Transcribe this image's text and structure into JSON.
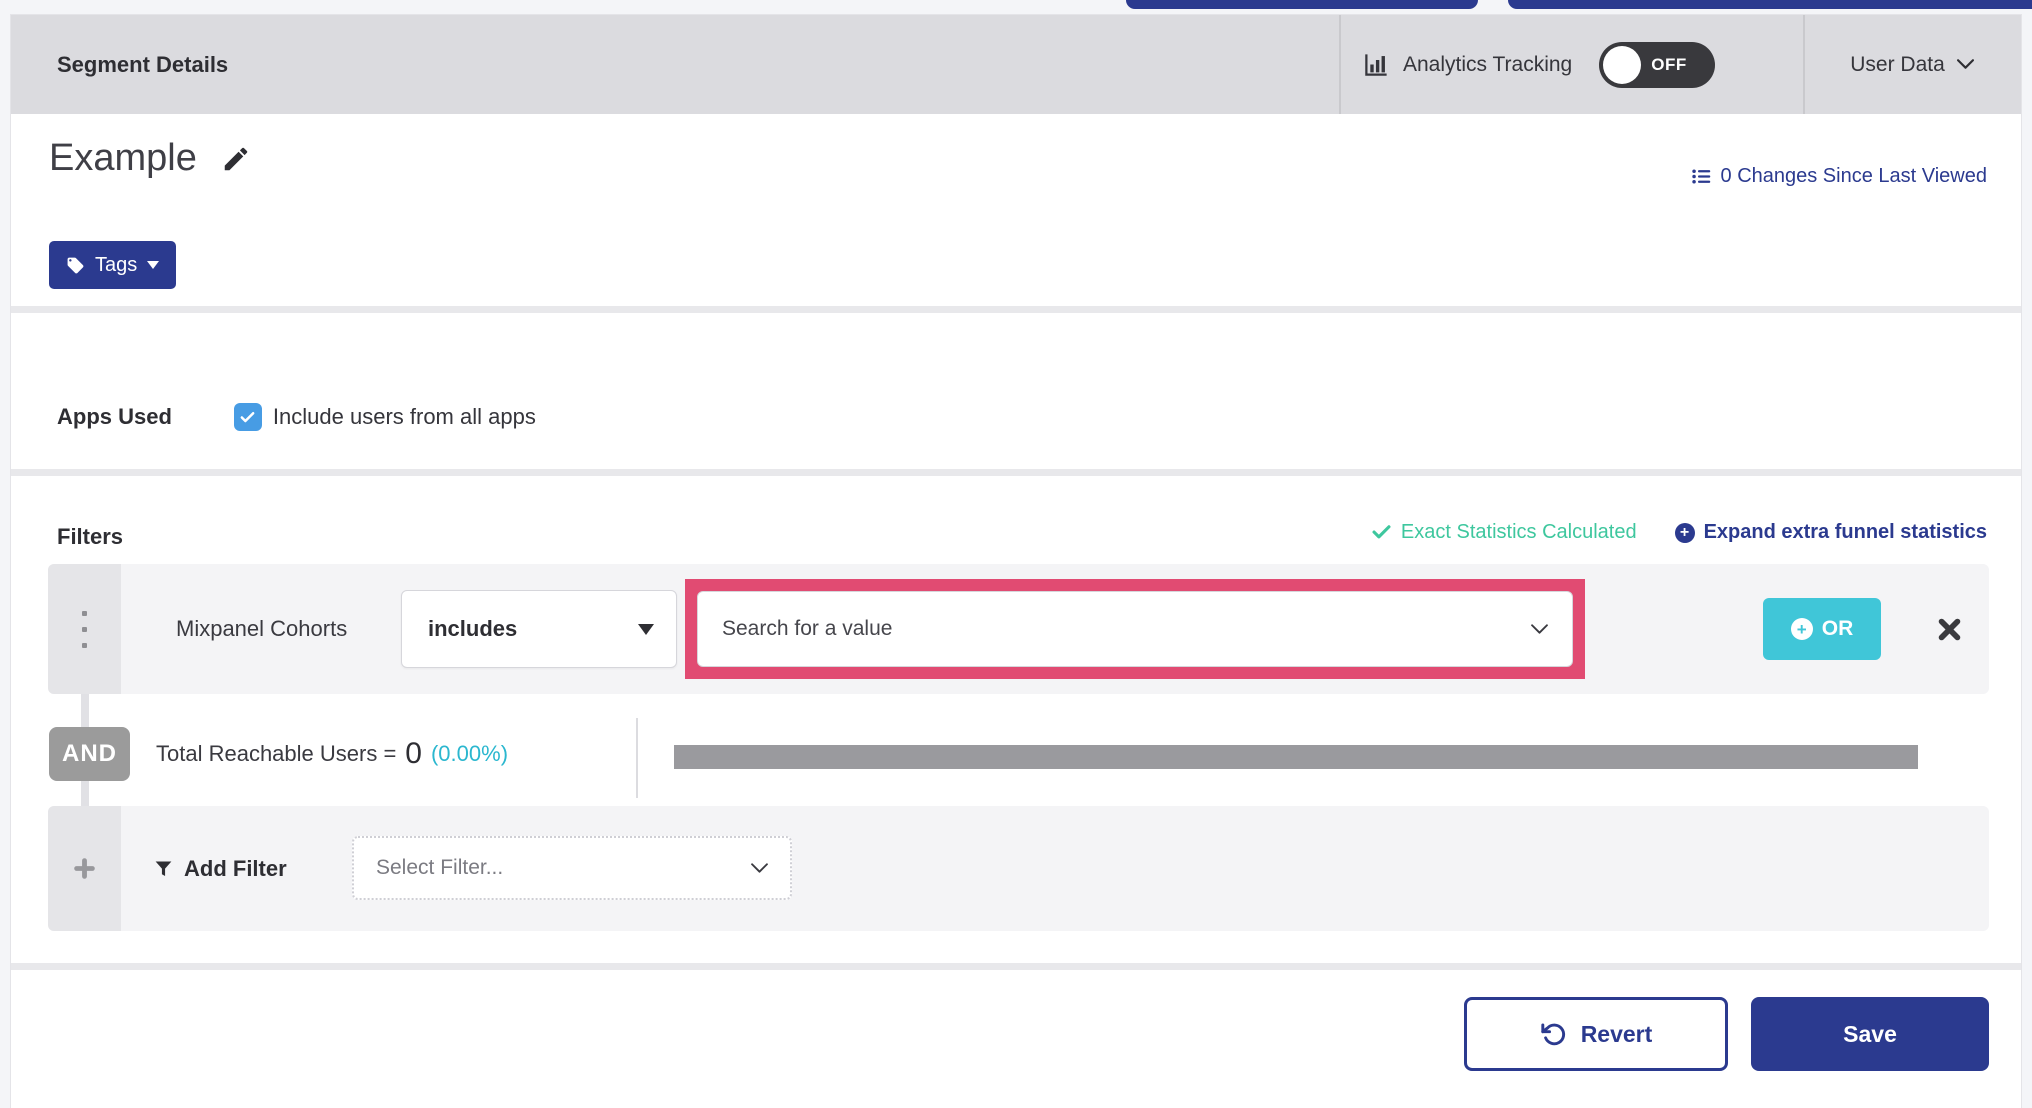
{
  "header": {
    "title": "Segment Details",
    "analytics_tracking": {
      "label": "Analytics Tracking",
      "state": "OFF"
    },
    "user_data": {
      "label": "User Data"
    }
  },
  "segment": {
    "name": "Example",
    "tags_button": "Tags",
    "changes_link": "0 Changes Since Last Viewed"
  },
  "apps_used": {
    "label": "Apps Used",
    "checkbox_label": "Include users from all apps",
    "checkbox_checked": true
  },
  "filters": {
    "heading": "Filters",
    "exact_statistics": "Exact Statistics Calculated",
    "expand_link": "Expand extra funnel statistics",
    "filter_row": {
      "field": "Mixpanel Cohorts",
      "operator": "includes",
      "value_placeholder": "Search for a value",
      "or_button": "OR"
    },
    "connector": "AND",
    "total_reachable": {
      "label": "Total Reachable Users =",
      "value": "0",
      "percent": "(0.00%)"
    },
    "add_filter": {
      "label": "Add Filter",
      "placeholder": "Select Filter..."
    }
  },
  "footer": {
    "revert": "Revert",
    "save": "Save"
  },
  "icons": {
    "analytics": "bar-chart",
    "user_data": "chevron-down",
    "edit_name": "pencil",
    "tags": "tag",
    "changes": "list",
    "exact_statistics": "check",
    "expand": "plus-circle",
    "drag_handle": "vertical-dots",
    "or": "plus-circle",
    "remove_filter": "x",
    "add_filter": "funnel",
    "revert": "undo-arrow"
  },
  "colors": {
    "brand_navy": "#2b3a8f",
    "teal_success": "#3ec79e",
    "cyan_accent": "#40c6d8",
    "cyan_text": "#2bb7cf",
    "highlight_pink": "#e14b72",
    "checkbox_blue": "#479ce4",
    "toggle_off_bg": "#39393d",
    "header_gray": "#dbdbdf"
  }
}
